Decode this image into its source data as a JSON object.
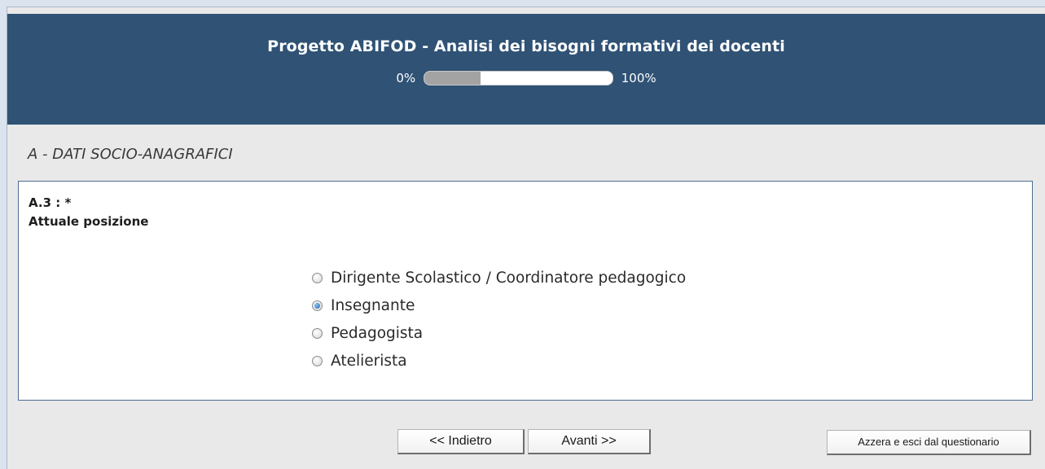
{
  "header": {
    "title": "Progetto ABIFOD - Analisi dei bisogni formativi dei docenti",
    "progress_start_label": "0%",
    "progress_end_label": "100%",
    "progress_fraction": 0.3
  },
  "section": {
    "title": "A - DATI SOCIO-ANAGRAFICI"
  },
  "question": {
    "code": "A.3 : ",
    "required_marker": "*",
    "text": "Attuale posizione",
    "options": [
      {
        "label": "Dirigente Scolastico / Coordinatore pedagogico",
        "checked": false
      },
      {
        "label": "Insegnante",
        "checked": true
      },
      {
        "label": "Pedagogista",
        "checked": false
      },
      {
        "label": "Atelierista",
        "checked": false
      }
    ]
  },
  "buttons": {
    "back_label": "<< Indietro",
    "next_label": "Avanti >>",
    "reset_label": "Azzera e esci dal questionario"
  },
  "colors": {
    "header_bg": "#2f5275",
    "page_bg": "#e9e9e9",
    "progress_fill": "#a3a3a3"
  }
}
